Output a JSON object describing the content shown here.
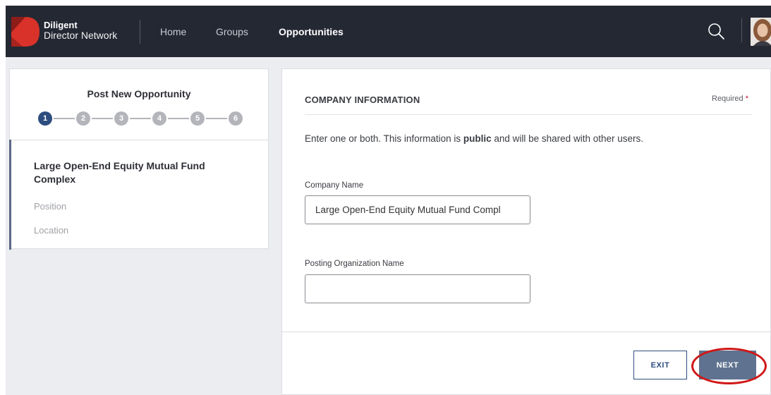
{
  "app": {
    "brand_line1": "Diligent",
    "brand_line2": "Director Network",
    "brand_color": "#d8322a",
    "accent_color": "#2d4d7e"
  },
  "nav": {
    "items": [
      {
        "label": "Home",
        "active": false
      },
      {
        "label": "Groups",
        "active": false
      },
      {
        "label": "Opportunities",
        "active": true
      }
    ],
    "search_icon": "search-icon",
    "avatar_icon": "user-avatar"
  },
  "wizard": {
    "title": "Post New Opportunity",
    "current_step": 1,
    "steps": [
      "1",
      "2",
      "3",
      "4",
      "5",
      "6"
    ],
    "summary": {
      "company": "Large Open-End Equity Mutual Fund Complex",
      "position": "Position",
      "location": "Location"
    }
  },
  "form": {
    "section_title": "COMPANY INFORMATION",
    "required_label": "Required",
    "required_marker": "*",
    "help_prefix": "Enter one or both. This information is ",
    "help_bold": "public",
    "help_suffix": " and will be shared with other users.",
    "company_name": {
      "label": "Company Name",
      "value": "Large Open-End Equity Mutual Fund Compl"
    },
    "posting_org": {
      "label": "Posting Organization Name",
      "value": ""
    }
  },
  "actions": {
    "exit_label": "EXIT",
    "next_label": "NEXT"
  }
}
